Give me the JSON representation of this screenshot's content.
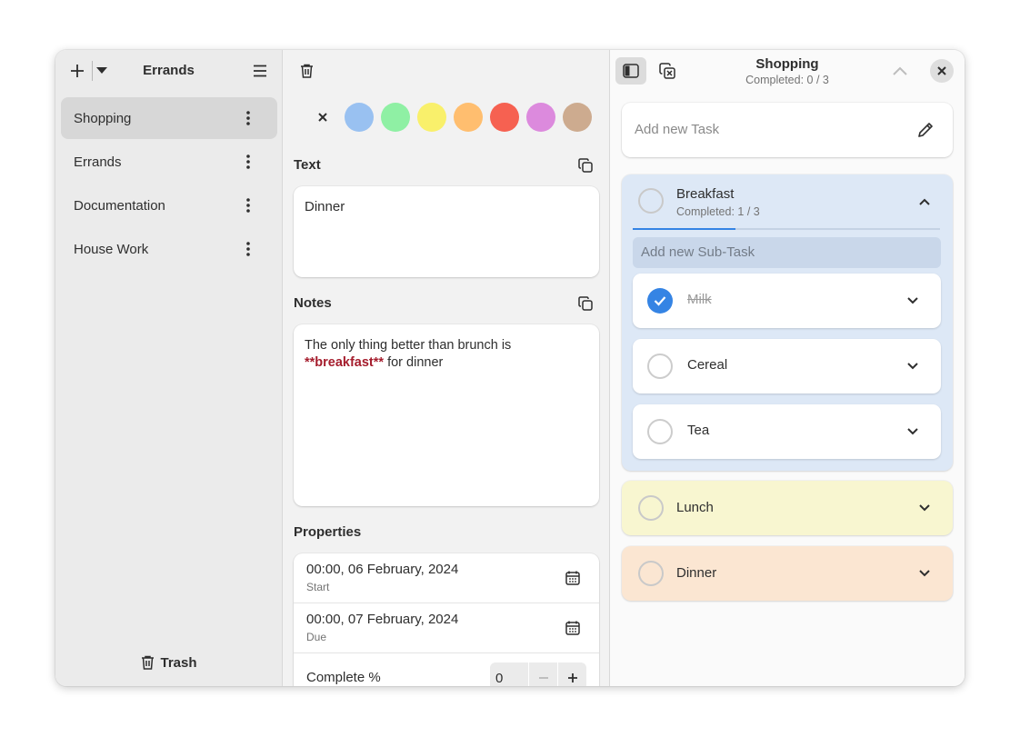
{
  "sidebar": {
    "title": "Errands",
    "items": [
      {
        "label": "Shopping"
      },
      {
        "label": "Errands"
      },
      {
        "label": "Documentation"
      },
      {
        "label": "House Work"
      }
    ],
    "trash_label": "Trash"
  },
  "details": {
    "colors": [
      "#99c1f1",
      "#8ff0a4",
      "#f9f06b",
      "#ffbe6f",
      "#f66151",
      "#dc8add",
      "#cdab8f"
    ],
    "text_section": "Text",
    "text_value": "Dinner",
    "notes_section": "Notes",
    "notes_before": "The only thing better than brunch is ",
    "notes_bold": "**breakfast**",
    "notes_after": " for dinner",
    "properties_section": "Properties",
    "start_value": "00:00, 06 February, 2024",
    "start_label": "Start",
    "due_value": "00:00, 07 February, 2024",
    "due_label": "Due",
    "complete_label": "Complete %",
    "complete_value": "0"
  },
  "tasks_pane": {
    "title": "Shopping",
    "subtitle": "Completed: 0 / 3",
    "add_task_placeholder": "Add new Task",
    "groups": [
      {
        "name": "Breakfast",
        "subtitle": "Completed: 1 / 3",
        "color": "#dde8f6",
        "progress": 0.333,
        "subtask_placeholder": "Add new Sub-Task",
        "subtasks": [
          {
            "name": "Milk",
            "done": true
          },
          {
            "name": "Cereal",
            "done": false
          },
          {
            "name": "Tea",
            "done": false
          }
        ]
      },
      {
        "name": "Lunch",
        "color": "#f8f6d0"
      },
      {
        "name": "Dinner",
        "color": "#fbe6d2"
      }
    ]
  }
}
